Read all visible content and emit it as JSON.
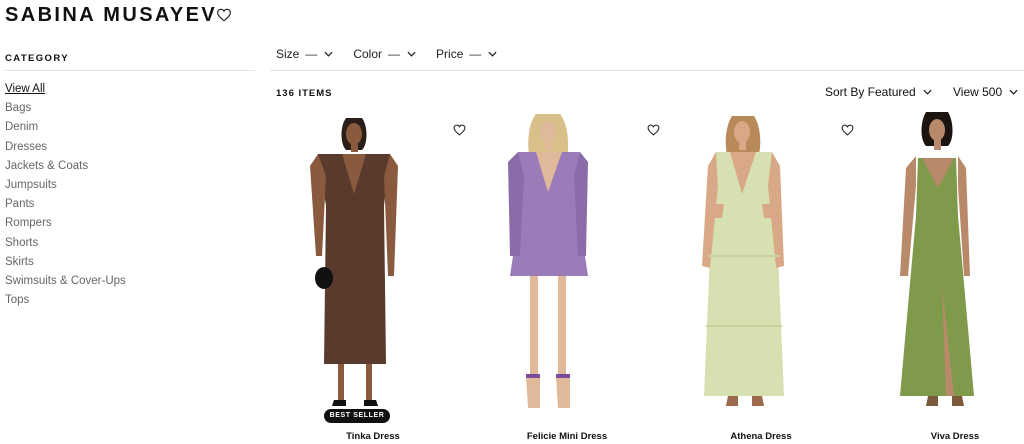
{
  "brand": {
    "name": "SABINA MUSAYEV"
  },
  "sidebar": {
    "title": "CATEGORY",
    "items": [
      {
        "label": "View All"
      },
      {
        "label": "Bags"
      },
      {
        "label": "Denim"
      },
      {
        "label": "Dresses"
      },
      {
        "label": "Jackets & Coats"
      },
      {
        "label": "Jumpsuits"
      },
      {
        "label": "Pants"
      },
      {
        "label": "Rompers"
      },
      {
        "label": "Shorts"
      },
      {
        "label": "Skirts"
      },
      {
        "label": "Swimsuits & Cover-Ups"
      },
      {
        "label": "Tops"
      }
    ]
  },
  "filters": [
    {
      "label": "Size"
    },
    {
      "label": "Color"
    },
    {
      "label": "Price"
    }
  ],
  "results": {
    "count": "136 ITEMS",
    "sort_label": "Sort By Featured",
    "view_label": "View 500"
  },
  "products": [
    {
      "name": "Tinka Dress",
      "badge": "BEST SELLER",
      "color": "#5a3a2c"
    },
    {
      "name": "Felicie Mini Dress",
      "color": "#9a7cb8"
    },
    {
      "name": "Athena Dress",
      "color": "#d7e0b0"
    },
    {
      "name": "Viva Dress",
      "color": "#7f9a4a"
    }
  ]
}
